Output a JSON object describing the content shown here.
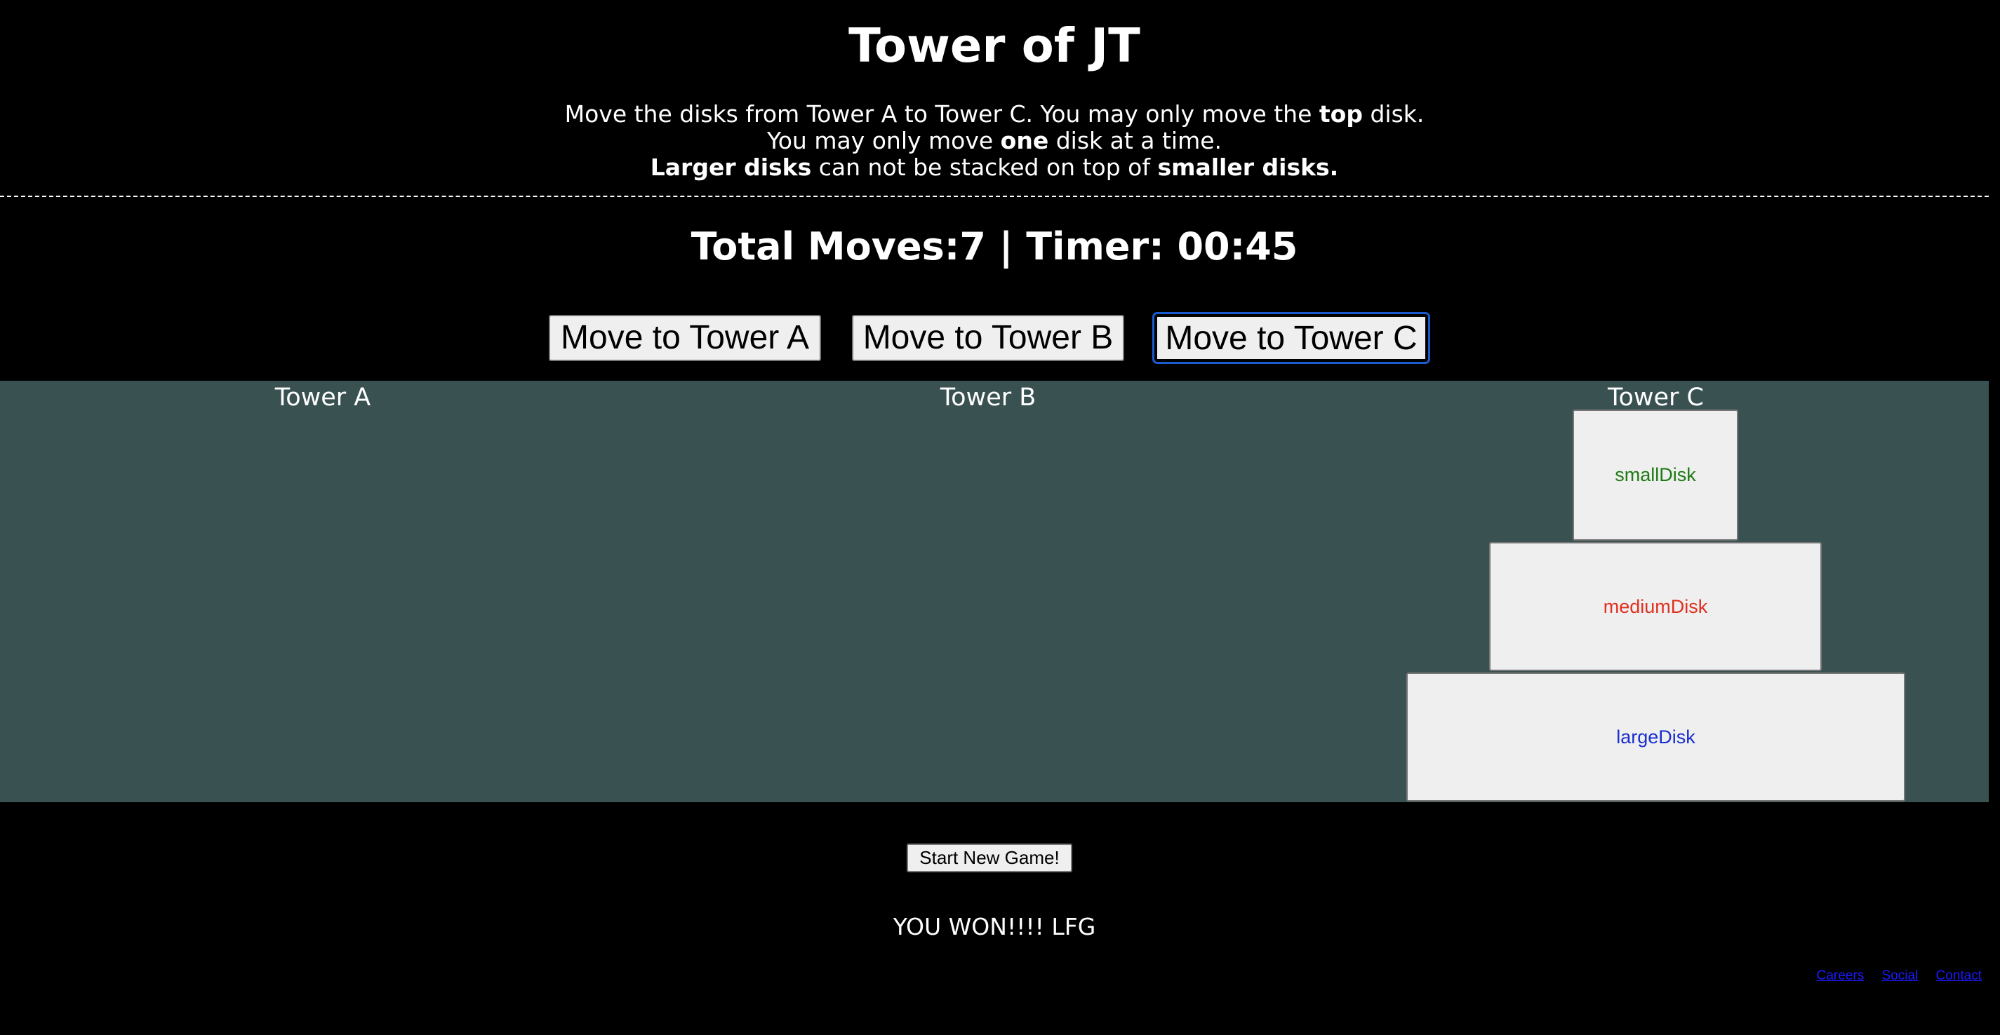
{
  "header": {
    "title": "Tower of JT",
    "rules": {
      "line1_prefix": "Move the disks from Tower A to Tower C. You may only move the ",
      "line1_bold": "top",
      "line1_suffix": " disk.",
      "line2_prefix": "You may only move ",
      "line2_bold": "one",
      "line2_suffix": " disk at a time.",
      "line3_bold1": "Larger disks",
      "line3_mid": " can not be stacked on top of ",
      "line3_bold2": "smaller disks."
    }
  },
  "stats": {
    "text": "Total Moves:7 | Timer: 00:45",
    "total_moves": 7,
    "timer": "00:45"
  },
  "controls": {
    "move_a": "Move to Tower A",
    "move_b": "Move to Tower B",
    "move_c": "Move to Tower C",
    "focused": "Move to Tower C"
  },
  "board": {
    "background": "#3a5152",
    "towers": [
      {
        "label": "Tower A",
        "disks": []
      },
      {
        "label": "Tower B",
        "disks": []
      },
      {
        "label": "Tower C",
        "disks": [
          "smallDisk",
          "mediumDisk",
          "largeDisk"
        ]
      }
    ],
    "disks": {
      "small": {
        "label": "smallDisk",
        "color": "#1e7a14"
      },
      "medium": {
        "label": "mediumDisk",
        "color": "#e03020"
      },
      "large": {
        "label": "largeDisk",
        "color": "#1a2ecf"
      }
    }
  },
  "new_game_label": "Start New Game!",
  "win_message": "YOU WON!!!! LFG",
  "footer": {
    "links": [
      "Careers",
      "Social",
      "Contact"
    ]
  }
}
